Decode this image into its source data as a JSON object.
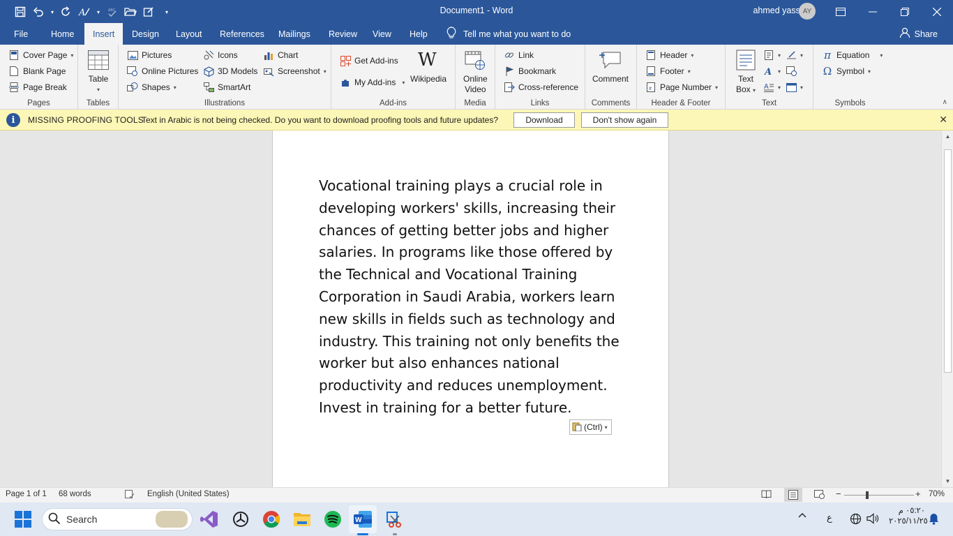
{
  "window": {
    "title": "Document1  -  Word",
    "user_name": "ahmed yasser",
    "user_initials": "AY"
  },
  "tabs": [
    "File",
    "Home",
    "Insert",
    "Design",
    "Layout",
    "References",
    "Mailings",
    "Review",
    "View",
    "Help"
  ],
  "tell_me": "Tell me what you want to do",
  "share": "Share",
  "ribbon": {
    "pages": {
      "label": "Pages",
      "cover_page": "Cover Page",
      "blank_page": "Blank Page",
      "page_break": "Page Break"
    },
    "tables": {
      "label": "Tables",
      "table": "Table"
    },
    "illustrations": {
      "label": "Illustrations",
      "pictures": "Pictures",
      "online_pictures": "Online Pictures",
      "shapes": "Shapes",
      "icons": "Icons",
      "models_3d": "3D Models",
      "smartart": "SmartArt",
      "chart": "Chart",
      "screenshot": "Screenshot"
    },
    "addins": {
      "label": "Add-ins",
      "get_addins": "Get Add-ins",
      "my_addins": "My Add-ins",
      "wikipedia": "Wikipedia"
    },
    "media": {
      "label": "Media",
      "online_video_1": "Online",
      "online_video_2": "Video"
    },
    "links": {
      "label": "Links",
      "link": "Link",
      "bookmark": "Bookmark",
      "cross_reference": "Cross-reference"
    },
    "comments": {
      "label": "Comments",
      "comment": "Comment"
    },
    "header_footer": {
      "label": "Header & Footer",
      "header": "Header",
      "footer": "Footer",
      "page_number": "Page Number"
    },
    "text": {
      "label": "Text",
      "text_box_1": "Text",
      "text_box_2": "Box"
    },
    "symbols": {
      "label": "Symbols",
      "equation": "Equation",
      "symbol": "Symbol"
    }
  },
  "message_bar": {
    "title": "MISSING PROOFING TOOLS",
    "text": "Text in Arabic is not being checked. Do you want to download proofing tools and future updates?",
    "download": "Download",
    "dont_show": "Don't show again"
  },
  "document": {
    "lines": [
      "Vocational training plays a crucial role in",
      "developing workers' skills, increasing their",
      "chances of getting better jobs and higher",
      "salaries. In programs like those offered by",
      "the Technical and Vocational Training",
      "Corporation in Saudi Arabia, workers learn",
      "new skills in fields such as technology and",
      "industry. This training not only benefits the",
      "worker but also enhances national",
      "productivity and reduces unemployment.",
      "Invest in training for a better future."
    ],
    "paste_options": "(Ctrl)"
  },
  "status": {
    "page": "Page 1 of 1",
    "words": "68 words",
    "language": "English (United States)",
    "zoom": "70%"
  },
  "taskbar": {
    "search": "Search",
    "ime": "ع",
    "time": "٠٥:٢٠ م",
    "date": "٢٠٢٥/١١/٢٥"
  },
  "colors": {
    "word_blue": "#2b579a",
    "message_bar": "#fcf7b6",
    "ribbon_bg": "#f3f3f3"
  }
}
